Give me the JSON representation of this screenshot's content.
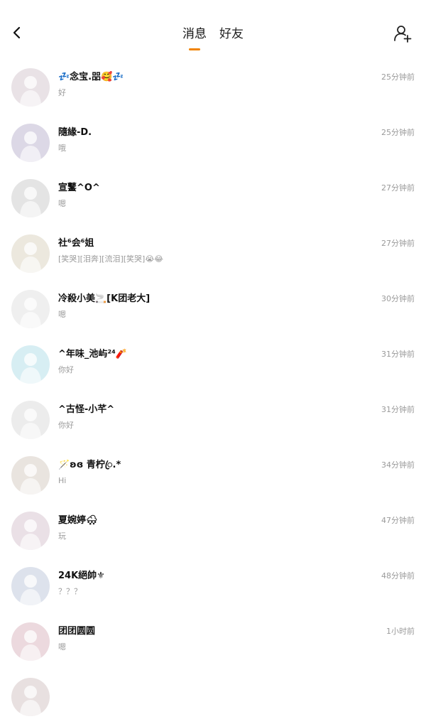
{
  "colors": {
    "accent": "#f08300",
    "name_text": "#111111",
    "secondary_text": "#9a9a9a"
  },
  "header": {
    "back_icon": "chevron-left-icon",
    "tabs": [
      {
        "label": "消息",
        "active": true
      },
      {
        "label": "好友",
        "active": false
      }
    ],
    "add_friend_icon": "add-person-icon"
  },
  "conversations": [
    {
      "name": "💤念宝.㗊🥰💤",
      "preview": "好",
      "time": "25分钟前",
      "avatar_color": "#e9e2e6"
    },
    {
      "name": "隨緣-D.",
      "preview": "哦",
      "time": "25分钟前",
      "avatar_color": "#dcd8e6"
    },
    {
      "name": "宣鼜^O^",
      "preview": "嗯",
      "time": "27分钟前",
      "avatar_color": "#e4e4e4"
    },
    {
      "name": "社⁶会⁶姐",
      "preview": "[笑哭][泪奔][流泪][笑哭]😭😂",
      "time": "27分钟前",
      "avatar_color": "#ece8de"
    },
    {
      "name": "冷殺小美🚬[K团老大]",
      "preview": "嗯",
      "time": "30分钟前",
      "avatar_color": "#efefef"
    },
    {
      "name": "^年味_池屿²⁴🧨",
      "preview": "你好",
      "time": "31分钟前",
      "avatar_color": "#d7eef3"
    },
    {
      "name": "^古怪-小芊^",
      "preview": "你好",
      "time": "31分钟前",
      "avatar_color": "#ececec"
    },
    {
      "name": "🪄ʚɞ 青柠ꦿ.*",
      "preview": "Hi",
      "time": "34分钟前",
      "avatar_color": "#e9e4df"
    },
    {
      "name": "夏婉婷🌨",
      "preview": "玩",
      "time": "47分钟前",
      "avatar_color": "#eae0e6"
    },
    {
      "name": "24K絕帥⚜",
      "preview": "？？？",
      "time": "48分钟前",
      "avatar_color": "#dde2ec"
    },
    {
      "name": "团团圆圆",
      "preview": "嗯",
      "time": "1小时前",
      "avatar_color": "#ecd9de"
    },
    {
      "name": "",
      "preview": "",
      "time": "",
      "avatar_color": "#e8e0e0"
    }
  ]
}
